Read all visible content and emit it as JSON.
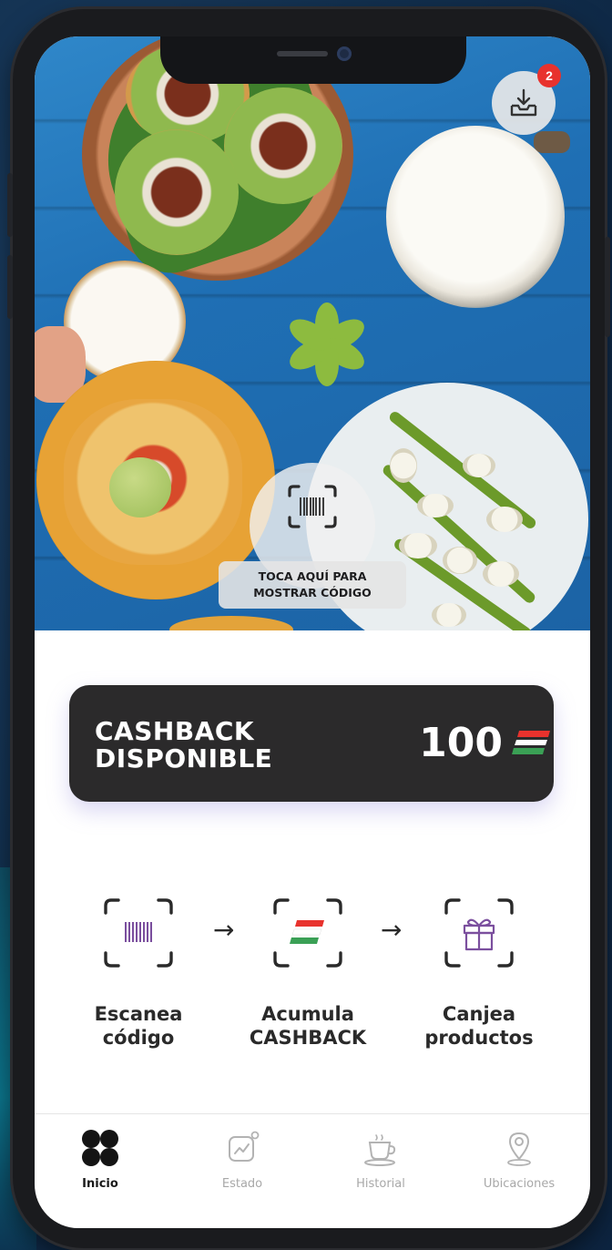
{
  "header": {
    "inbox_badge_count": "2",
    "inbox_icon": "inbox-download-icon"
  },
  "hero": {
    "scan_prompt": "TOCA AQUÍ PARA\nMOSTRAR CÓDIGO",
    "scan_icon": "barcode-scan-icon"
  },
  "cashback": {
    "label": "CASHBACK\nDISPONIBLE",
    "amount": "100",
    "currency_icon": "flag-mark-icon",
    "colors": {
      "card_bg": "#2b2a2b",
      "red": "#e8322d",
      "green": "#3aa055"
    }
  },
  "steps": [
    {
      "label": "Escanea\ncódigo",
      "icon": "barcode-scan-icon"
    },
    {
      "label": "Acumula\nCASHBACK",
      "icon": "flag-mark-icon"
    },
    {
      "label": "Canjea\nproductos",
      "icon": "gift-icon"
    }
  ],
  "nav": {
    "items": [
      {
        "label": "Inicio",
        "icon": "home-grid-icon",
        "active": true
      },
      {
        "label": "Estado",
        "icon": "chart-icon",
        "active": false
      },
      {
        "label": "Historial",
        "icon": "coffee-cup-icon",
        "active": false
      },
      {
        "label": "Ubicaciones",
        "icon": "location-pin-icon",
        "active": false
      }
    ]
  }
}
